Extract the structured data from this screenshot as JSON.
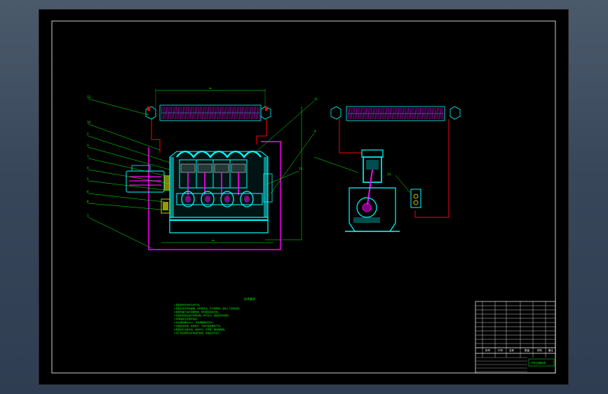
{
  "drawing": {
    "callouts_left": [
      "12",
      "10",
      "2",
      "3",
      "7",
      "4",
      "5",
      "6",
      "8",
      "1"
    ],
    "callouts_right": [
      "11",
      "9",
      "13"
    ],
    "callout_valve": "14",
    "dim_top": "86",
    "dim_bottom": "86",
    "notes_title": "技术要求",
    "notes": [
      "1.装配前所有零件清洗干净。",
      "2.装配后用手转动曲轴，应转动灵活，无卡滞现象，活塞上下运动自如。",
      "3.各密封面不得有泄漏现象，密封垫应完好无损。",
      "4.压缩机装配后进行性能试验，排气压力、温度应符合规定。",
      "5.润滑油加注至规定油位。",
      "6.未注明倒角均为C1，未注明圆角均为R1。",
      "7.管路连接牢固，走向整齐，不得与运动部件干涉。",
      "8.装配后外表面清洁，涂漆均匀，无流挂、漏涂等缺陷。",
      "9.出厂前应按有关标准进行检验，合格后方可出厂。"
    ]
  },
  "title_block": {
    "drawing_title": "汽车空调系统",
    "headers": [
      "序号",
      "代号",
      "名称",
      "数量",
      "材料",
      "备注"
    ]
  },
  "colors": {
    "background": "#000000",
    "frame": "#ffffff",
    "geometry": "#00ffff",
    "pipe": "#ff0000",
    "pipe_loop": "#ff00ff",
    "leader": "#00ff00",
    "condenser_fin": "#ff00ff"
  }
}
